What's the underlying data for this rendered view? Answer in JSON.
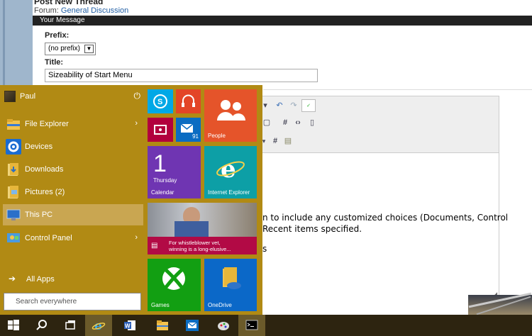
{
  "page": {
    "thread_title": "Post New Thread",
    "forum_label": "Forum:",
    "forum_name": "General Discussion",
    "message_bar": "Your Message",
    "prefix_label": "Prefix:",
    "prefix_value": "(no prefix)",
    "title_label": "Title:",
    "title_value": "Sizeability of Start Menu"
  },
  "editor": {
    "line1": "n to include any customized choices (Documents, Control",
    "line2": "Recent items specified.",
    "line3": "s"
  },
  "start_menu": {
    "user_name": "Paul",
    "items": [
      {
        "label": "File Explorer",
        "icon": "folder-icon"
      },
      {
        "label": "Devices",
        "icon": "gear-icon"
      },
      {
        "label": "Downloads",
        "icon": "downloads-folder-icon"
      },
      {
        "label": "Pictures (2)",
        "icon": "pictures-folder-icon"
      },
      {
        "label": "This PC",
        "icon": "computer-icon"
      },
      {
        "label": "Control Panel",
        "icon": "control-panel-icon"
      }
    ],
    "all_apps": "All Apps",
    "search_placeholder": "Search everywhere",
    "colors": {
      "menu_bg": "#b18a14",
      "selected_bg": "#c9a651"
    }
  },
  "tiles": {
    "skype": {
      "icon": "skype-icon",
      "color": "#00a8e6"
    },
    "music": {
      "icon": "headphones-icon",
      "color": "#e34527"
    },
    "video": {
      "icon": "video-icon",
      "color": "#b2003d"
    },
    "mail": {
      "icon": "mail-icon",
      "badge": "91",
      "color": "#0a6cc2"
    },
    "people": {
      "label": "People",
      "color": "#e5542a"
    },
    "calendar": {
      "day": "1",
      "weekday": "Thursday",
      "label": "Calendar",
      "color": "#6f35b2"
    },
    "ie": {
      "label": "Internet Explorer",
      "color": "#0d9fa6"
    },
    "news": {
      "headline1": "For whistleblower vet,",
      "headline2": "winning is a long-elusive...",
      "color": "#b20a45"
    },
    "games": {
      "label": "Games",
      "color": "#129f12"
    },
    "onedrive": {
      "label": "OneDrive",
      "color": "#0b68c8"
    }
  },
  "taskbar": {
    "items": [
      "start-icon",
      "search-icon",
      "task-view-icon",
      "internet-explorer-icon",
      "word-icon",
      "file-explorer-icon",
      "mail-icon",
      "paint-icon",
      "command-prompt-icon"
    ]
  }
}
